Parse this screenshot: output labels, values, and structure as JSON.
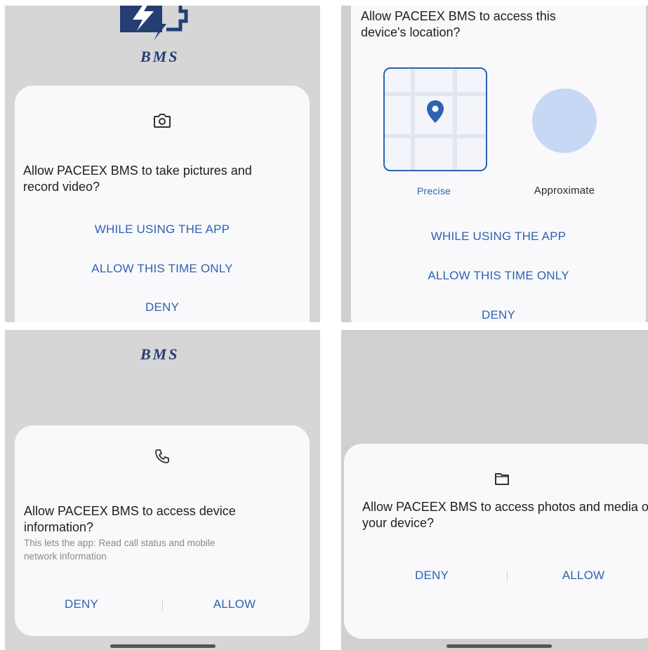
{
  "camera_panel": {
    "logo_text": "BMS",
    "icon": "camera-icon",
    "title": "Allow PACEEX BMS to take pictures and record video?",
    "buttons": [
      "WHILE USING THE APP",
      "ALLOW THIS TIME ONLY",
      "DENY"
    ]
  },
  "location_panel": {
    "title": "Allow PACEEX BMS to access this device's location?",
    "precise_label": "Precise",
    "approximate_label": "Approximate",
    "selected": "Precise",
    "buttons": [
      "WHILE USING THE APP",
      "ALLOW THIS TIME ONLY",
      "DENY"
    ]
  },
  "phone_panel": {
    "logo_text": "BMS",
    "icon": "phone-icon",
    "title": "Allow PACEEX BMS to access device information?",
    "subtitle": "This lets the app: Read call status and mobile network information",
    "deny_label": "DENY",
    "allow_label": "ALLOW"
  },
  "storage_panel": {
    "icon": "folder-icon",
    "title": "Allow PACEEX BMS to access photos and media on your device?",
    "deny_label": "DENY",
    "allow_label": "ALLOW"
  },
  "colors": {
    "accent": "#2d62b3",
    "dialog_bg": "#f9f9fb",
    "scrim": "#d6d6d6",
    "logo": "#243e74"
  }
}
